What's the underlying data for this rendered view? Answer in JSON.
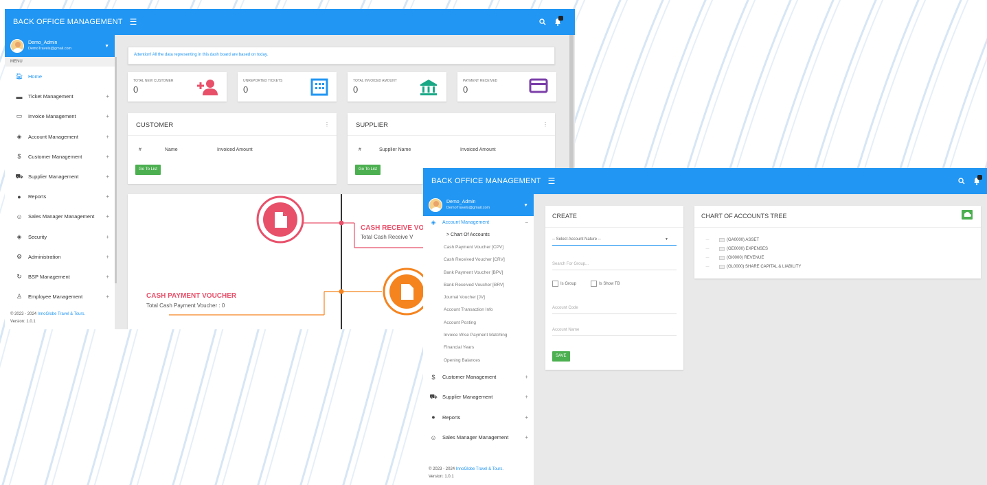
{
  "colors": {
    "primary": "#2196f3",
    "accent_red": "#e8506a",
    "accent_orange": "#f5841f",
    "button_green": "#4caf50",
    "teal": "#18a886",
    "purple": "#7b3fa8"
  },
  "dashboard": {
    "brand": "BACK OFFICE MANAGEMENT",
    "user": {
      "name": "Demo_Admin",
      "email": "DemoTravels@gmail.com"
    },
    "menu_header": "MENU",
    "nav": [
      {
        "label": "Home",
        "icon": "home-icon"
      },
      {
        "label": "Ticket Management",
        "icon": "ticket-icon"
      },
      {
        "label": "Invoice Management",
        "icon": "invoice-icon"
      },
      {
        "label": "Account Management",
        "icon": "shield-icon"
      },
      {
        "label": "Customer Management",
        "icon": "dollar-icon"
      },
      {
        "label": "Supplier Management",
        "icon": "cart-icon"
      },
      {
        "label": "Reports",
        "icon": "info-icon"
      },
      {
        "label": "Sales Manager Management",
        "icon": "face-icon"
      },
      {
        "label": "Security",
        "icon": "shield-icon"
      },
      {
        "label": "Administration",
        "icon": "gear-icon"
      },
      {
        "label": "BSP Management",
        "icon": "sync-icon"
      },
      {
        "label": "Employee Management",
        "icon": "person-icon"
      }
    ],
    "footer_copy": "© 2023 - 2024",
    "footer_company": "InnoGlobe Travel & Tours.",
    "footer_version": "Version: 1.0.1",
    "alert_strong": "Attention!",
    "alert_text": "All the data representing in this dash board are based on today.",
    "stats": [
      {
        "label": "TOTAL NEW CUSTOMER",
        "value": "0",
        "icon": "add-person-icon"
      },
      {
        "label": "UNREPORTED TICKETS",
        "value": "0",
        "icon": "building-icon"
      },
      {
        "label": "TOTAL INVOICED AMOUNT",
        "value": "0",
        "icon": "bank-icon"
      },
      {
        "label": "PAYMENT RECEIVED",
        "value": "0",
        "icon": "card-icon"
      }
    ],
    "customer": {
      "title": "CUSTOMER",
      "cols": [
        "#",
        "Name",
        "Invoiced Amount"
      ],
      "button": "Go To List"
    },
    "supplier": {
      "title": "SUPPLIER",
      "cols": [
        "#",
        "Supplier Name",
        "Invoiced Amount"
      ],
      "button": "Go To List"
    },
    "timeline": {
      "receive_title": "CASH RECEIVE VO",
      "receive_sub": "Total Cash Receive V",
      "payment_title": "CASH PAYMENT VOUCHER",
      "payment_sub": "Total Cash Payment Voucher : 0"
    }
  },
  "accounts": {
    "brand": "BACK OFFICE MANAGEMENT",
    "user": {
      "name": "Demo_Admin",
      "email": "DemoTravels@gmail.com"
    },
    "nav_open": {
      "label": "Account Management",
      "collapse": "−"
    },
    "sub_current": "> Chart Of Accounts",
    "sub_items": [
      "Cash Payment Voucher [CPV]",
      "Cash Received Voucher [CRV]",
      "Bank Payment Voucher [BPV]",
      "Bank Received Voucher [BRV]",
      "Journal Voucher [JV]",
      "Account Transaction Info",
      "Account Posting",
      "Invoice Wise Payment Matching",
      "Financial Years",
      "Opening Balances"
    ],
    "nav_rest": [
      {
        "label": "Customer Management",
        "icon": "dollar-icon"
      },
      {
        "label": "Supplier Management",
        "icon": "cart-icon"
      },
      {
        "label": "Reports",
        "icon": "info-icon"
      },
      {
        "label": "Sales Manager Management",
        "icon": "face-icon"
      }
    ],
    "footer_copy": "© 2023 - 2024",
    "footer_company": "InnoGlobe Travel & Tours.",
    "footer_version": "Version: 1.0.1",
    "create": {
      "title": "CREATE",
      "select_placeholder": "-- Select Account Nature --",
      "search_placeholder": "Search For Group...",
      "is_group": "Is Group",
      "is_show_tb": "Is Show TB",
      "code_placeholder": "Account Code",
      "name_placeholder": "Account Name",
      "save": "SAVE"
    },
    "tree": {
      "title": "CHART OF ACCOUNTS TREE",
      "nodes": [
        "(GA0000) ASSET",
        "(GE0000) EXPENSES",
        "(GI0000) REVENUE",
        "(GL0000) SHARE CAPITAL & LIABILITY"
      ]
    }
  }
}
